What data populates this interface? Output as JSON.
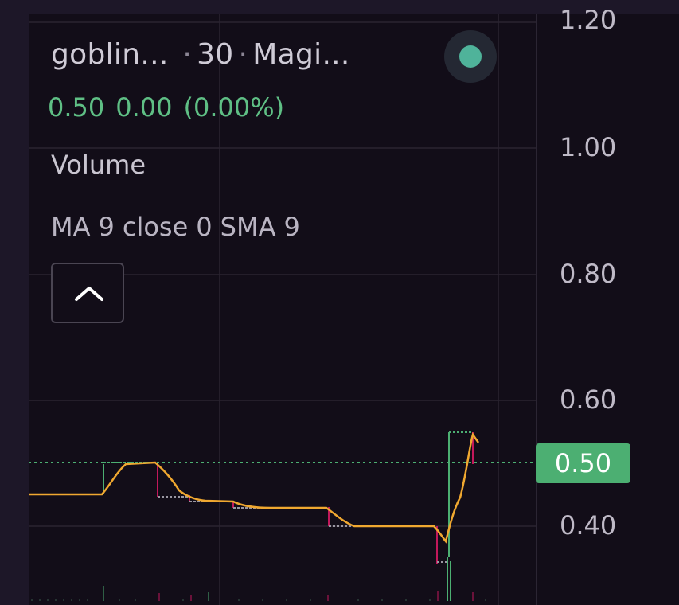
{
  "legend": {
    "symbol": "goblin...",
    "interval": "30",
    "exchange": "Magi..."
  },
  "ohlc": {
    "price": "0.50",
    "change": "0.00",
    "change_pct": "(0.00%)"
  },
  "indicators": {
    "volume": "Volume",
    "ma": [
      "MA",
      "9",
      "close",
      "0",
      "SMA",
      "9"
    ]
  },
  "price_axis": {
    "ticks": [
      "1.20",
      "1.00",
      "0.80",
      "0.60",
      "0.40"
    ],
    "current": "0.50"
  },
  "colors": {
    "up": "#4caf72",
    "down": "#c2185b",
    "ma_line": "#f0a830",
    "last_price_line": "#4caf72",
    "status_dot": "#4fb39a"
  },
  "icons": {
    "collapse": "chevron-up-icon",
    "status": "status-dot-icon"
  }
}
